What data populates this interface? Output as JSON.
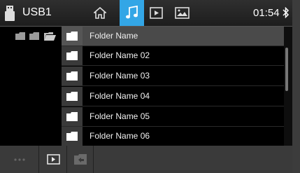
{
  "status_bar": {
    "source": "USB1",
    "time": "01:54"
  },
  "tabs": [
    {
      "id": "home",
      "icon": "home-icon",
      "active": false
    },
    {
      "id": "music",
      "icon": "music-note-icon",
      "active": true
    },
    {
      "id": "video",
      "icon": "video-play-icon",
      "active": false
    },
    {
      "id": "photo",
      "icon": "picture-icon",
      "active": false
    }
  ],
  "files": [
    {
      "label": "Folder Name",
      "selected": true
    },
    {
      "label": "Folder Name 02",
      "selected": false
    },
    {
      "label": "Folder Name 03",
      "selected": false
    },
    {
      "label": "Folder Name 04",
      "selected": false
    },
    {
      "label": "Folder Name 05",
      "selected": false
    },
    {
      "label": "Folder Name 06",
      "selected": false
    }
  ],
  "colors": {
    "accent": "#33a6e6",
    "background": "#000000",
    "row_selected": "#4a4a4a",
    "bar": "#3a3a3a"
  }
}
